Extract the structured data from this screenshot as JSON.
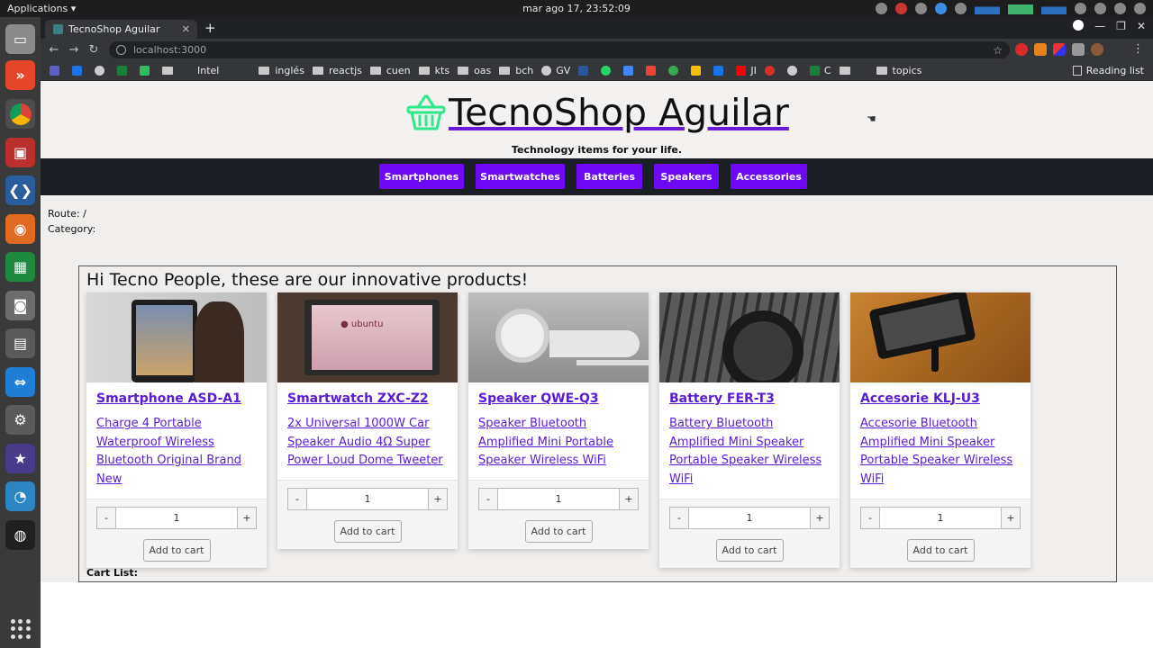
{
  "os": {
    "applications_menu": "Applications ▾",
    "clock": "mar ago 17, 23:52:09"
  },
  "browser": {
    "tab_title": "TecnoShop Aguilar",
    "tab_close": "✕",
    "new_tab": "+",
    "url": "localhost:3000",
    "bookmarks": [
      "Intel",
      "inglés",
      "reactjs",
      "cuen",
      "kts",
      "oas",
      "bch",
      "GV",
      "JI",
      "C",
      "topics"
    ],
    "reading_list": "Reading list"
  },
  "site": {
    "title": "TecnoShop Aguilar",
    "tagline": "Technology items for your life.",
    "nav": [
      "Smartphones",
      "Smartwatches",
      "Batteries",
      "Speakers",
      "Accessories"
    ],
    "route_label": "Route: /",
    "category_label": "Category:",
    "section_title": "Hi Tecno People, these are our innovative products!",
    "cart_list_label": "Cart List:"
  },
  "products": [
    {
      "name": "Smartphone ASD-A1",
      "description": "Charge 4 Portable Waterproof Wireless Bluetooth Original Brand New",
      "qty": "1",
      "add_label": "Add to cart",
      "minus": "-",
      "plus": "+"
    },
    {
      "name": "Smartwatch ZXC-Z2",
      "description": "2x Universal 1000W Car Speaker Audio 4Ω Super Power Loud Dome Tweeter",
      "qty": "1",
      "add_label": "Add to cart",
      "minus": "-",
      "plus": "+"
    },
    {
      "name": "Speaker QWE-Q3",
      "description": "Speaker Bluetooth Amplified Mini Portable Speaker Wireless WiFi",
      "qty": "1",
      "add_label": "Add to cart",
      "minus": "-",
      "plus": "+"
    },
    {
      "name": "Battery FER-T3",
      "description": "Battery Bluetooth Amplified Mini Speaker Portable Speaker Wireless WiFi",
      "qty": "1",
      "add_label": "Add to cart",
      "minus": "-",
      "plus": "+"
    },
    {
      "name": "Accesorie KLJ-U3",
      "description": "Accesorie Bluetooth Amplified Mini Speaker Portable Speaker Wireless WiFi",
      "qty": "1",
      "add_label": "Add to cart",
      "minus": "-",
      "plus": "+"
    }
  ],
  "colors": {
    "accent": "#6e09f6",
    "navbar_bg": "#1b1f25",
    "link": "#5a1bd6",
    "basket_icon": "#2ee88a"
  }
}
